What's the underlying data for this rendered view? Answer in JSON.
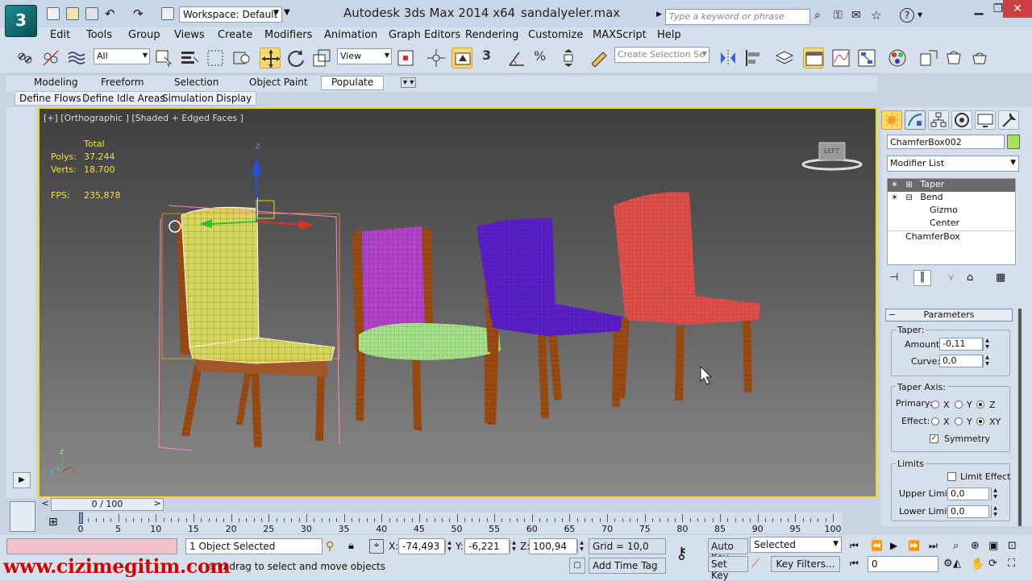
{
  "titlebar": {
    "workspace_label": "Workspace: Default",
    "app_title": "Autodesk 3ds Max  2014 x64",
    "file_name": "sandalyeler.max",
    "search_placeholder": "Type a keyword or phrase",
    "help_label": "?"
  },
  "menu": [
    "Edit",
    "Tools",
    "Group",
    "Views",
    "Create",
    "Modifiers",
    "Animation",
    "Graph Editors",
    "Rendering",
    "Customize",
    "MAXScript",
    "Help"
  ],
  "toolbar": {
    "selection_filter": "All",
    "ref_coord": "View",
    "named_selection": "Create Selection Se",
    "snap_label": "3",
    "angle_snap": "%"
  },
  "ribbon": {
    "tabs": [
      "Modeling",
      "Freeform",
      "Selection",
      "Object Paint",
      "Populate"
    ],
    "active_tab": "Populate",
    "subtabs": [
      "Define Flows",
      "Define Idle Areas",
      "Simulation",
      "Display"
    ]
  },
  "viewport": {
    "label": "[+] [Orthographic ] [Shaded + Edged Faces ]",
    "stats_header": "Total",
    "polys_label": "Polys:",
    "polys_value": "37.244",
    "verts_label": "Verts:",
    "verts_value": "18.700",
    "fps_label": "FPS:",
    "fps_value": "235,878",
    "gizmo_z": "z",
    "axis_x": "x",
    "axis_y": "y",
    "axis_z": "z",
    "viewcube_label": "LEFT"
  },
  "command_panel": {
    "object_name": "ChamferBox002",
    "object_color": "#a8e05a",
    "modifier_list": "Modifier List",
    "stack": [
      {
        "label": "Taper",
        "selected": true
      },
      {
        "label": "Bend",
        "selected": false
      },
      {
        "label": "Gizmo",
        "selected": false
      },
      {
        "label": "Center",
        "selected": false
      },
      {
        "label": "ChamferBox",
        "selected": false
      }
    ],
    "rollout_title": "Parameters",
    "taper_group": "Taper:",
    "amount_label": "Amount:",
    "amount_value": "-0,11",
    "curve_label": "Curve:",
    "curve_value": "0,0",
    "taper_axis_group": "Taper Axis:",
    "primary_label": "Primary:",
    "effect_label": "Effect:",
    "axis_x": "X",
    "axis_y": "Y",
    "axis_z": "Z",
    "axis_xy": "XY",
    "symmetry_label": "Symmetry",
    "symmetry_checked": true,
    "limits_group": "Limits",
    "limit_effect_label": "Limit Effect",
    "limit_effect_checked": false,
    "upper_limit_label": "Upper Limit:",
    "upper_limit_value": "0,0",
    "lower_limit_label": "Lower Limit:",
    "lower_limit_value": "0,0"
  },
  "timeline": {
    "frame_display": "0 / 100",
    "prev": "<",
    "next": ">",
    "ticks": [
      "0",
      "5",
      "10",
      "15",
      "20",
      "25",
      "30",
      "35",
      "40",
      "45",
      "50",
      "55",
      "60",
      "65",
      "70",
      "75",
      "80",
      "85",
      "90",
      "95",
      "100"
    ]
  },
  "status": {
    "selection_status": "1 Object Selected",
    "prompt": "and drag to select and move objects",
    "x_label": "X:",
    "x_value": "-74,493",
    "y_label": "Y:",
    "y_value": "-6,221",
    "z_label": "Z:",
    "z_value": "100,94",
    "grid_label": "Grid = 10,0",
    "add_time_tag": "Add Time Tag",
    "auto_key": "Auto Key",
    "set_key": "Set Key",
    "key_mode": "Selected",
    "key_filters": "Key Filters...",
    "current_frame": "0",
    "watermark": "www.cizimegitim.com"
  }
}
